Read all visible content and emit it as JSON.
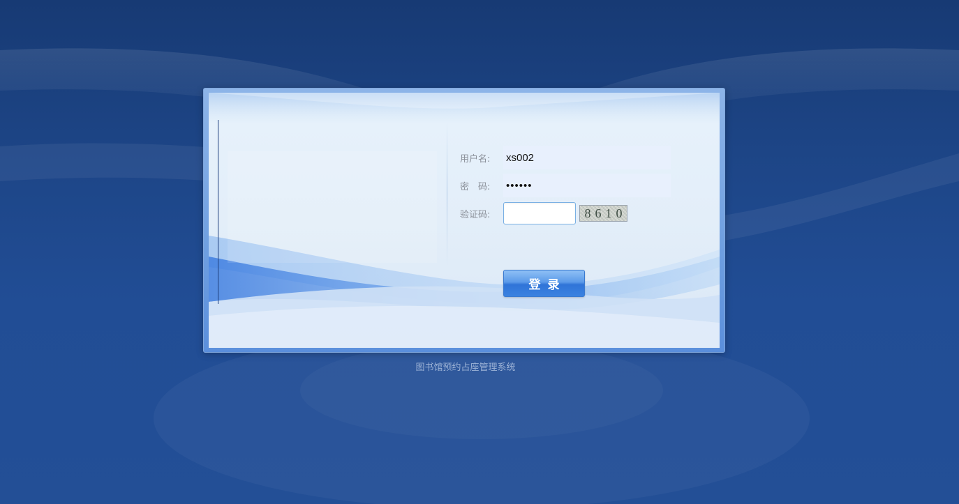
{
  "login": {
    "username_label": "用户名:",
    "username_value": "xs002",
    "password_label": "密　码:",
    "password_value": "••••••",
    "captcha_label": "验证码:",
    "captcha_value": "",
    "captcha_code": "8610",
    "submit_label": "登录"
  },
  "footer": {
    "system_name": "图书馆预约占座管理系统"
  },
  "colors": {
    "background": "#1d4586",
    "panel": "#e3eef9",
    "button": "#3b82e0",
    "input_fill": "#e8f0fd"
  }
}
